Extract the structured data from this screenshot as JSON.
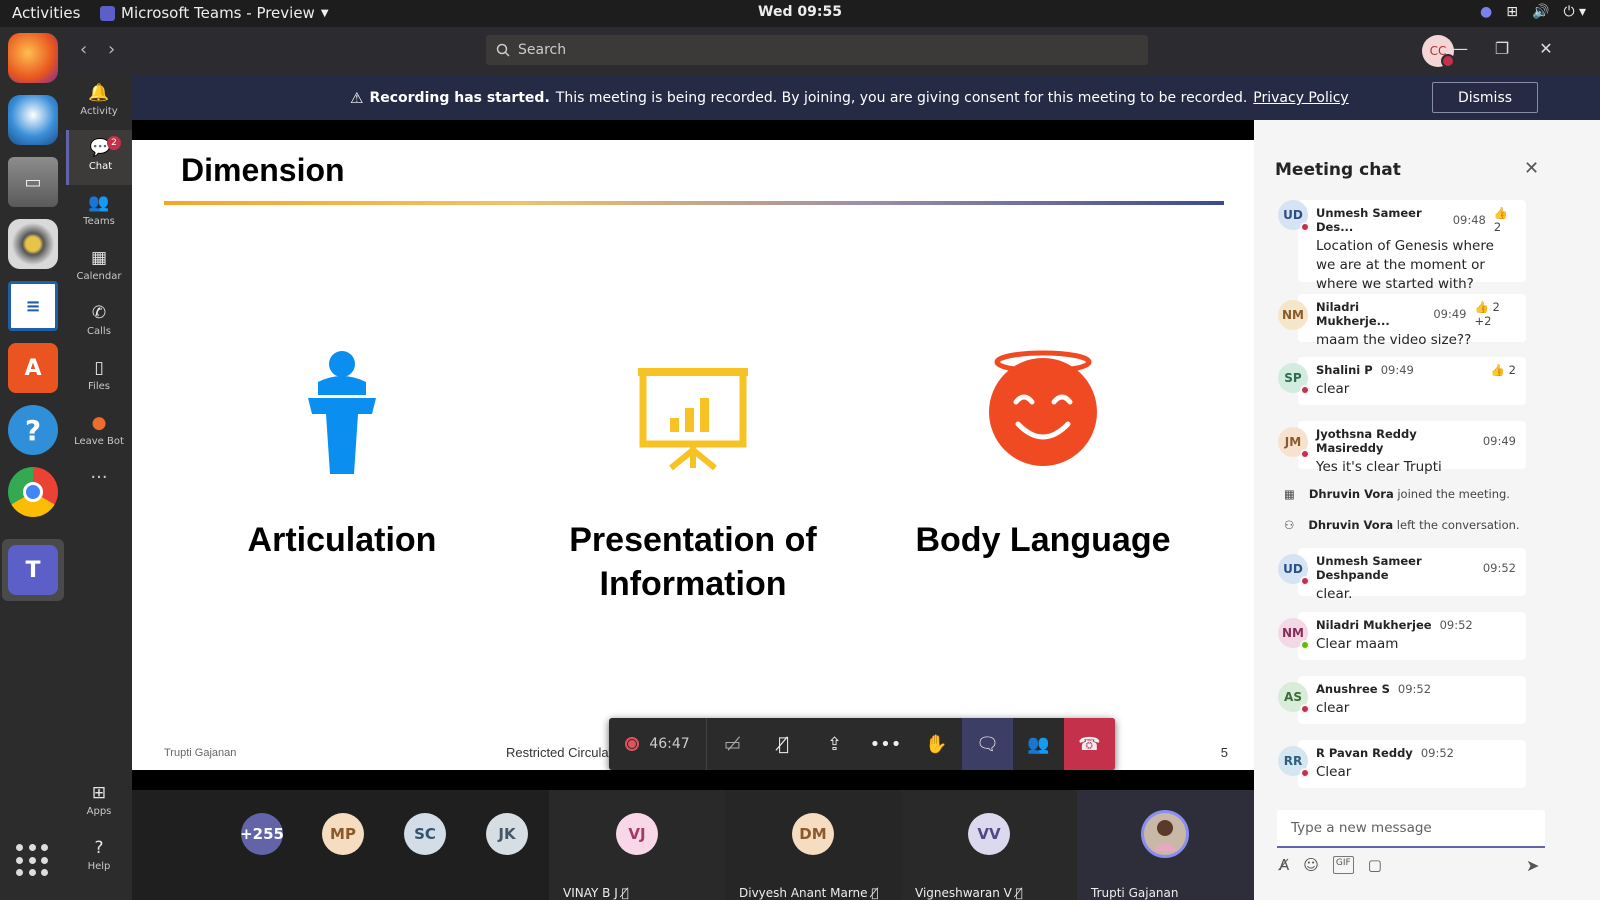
{
  "topbar": {
    "activities": "Activities",
    "app_name": "Microsoft Teams - Preview",
    "clock": "Wed 09:55"
  },
  "dock": {
    "items": [
      "firefox-icon",
      "thunderbird-icon",
      "files-icon",
      "rhythmbox-icon",
      "libreoffice-writer-icon",
      "software-icon",
      "help-icon",
      "chrome-icon",
      "teams-icon"
    ]
  },
  "titlebar": {
    "search_placeholder": "Search",
    "avatar_initials": "CC"
  },
  "appbar": {
    "items": [
      {
        "label": "Activity",
        "icon": "bell-icon"
      },
      {
        "label": "Chat",
        "icon": "chat-icon",
        "badge": "2"
      },
      {
        "label": "Teams",
        "icon": "teams-icon"
      },
      {
        "label": "Calendar",
        "icon": "calendar-icon"
      },
      {
        "label": "Calls",
        "icon": "phone-icon"
      },
      {
        "label": "Files",
        "icon": "file-icon"
      },
      {
        "label": "Leave Bot",
        "icon": "bot-icon"
      }
    ],
    "more": "···",
    "apps": "Apps",
    "help": "Help"
  },
  "banner": {
    "bold": "Recording has started.",
    "text": "This meeting is being recorded. By joining, you are giving consent for this meeting to be recorded.",
    "link": "Privacy Policy",
    "dismiss": "Dismiss"
  },
  "slide": {
    "title": "Dimension",
    "items": [
      {
        "label": "Articulation",
        "icon": "podium-icon"
      },
      {
        "label": "Presentation of Information",
        "icon": "presentation-board-icon"
      },
      {
        "label": "Body Language",
        "icon": "smiley-face-icon"
      }
    ],
    "presenter_mark": "Trupti Gajanan",
    "footer": "Restricted Circulation | L&T Technology Services | www.LTTS.com",
    "page_number": "5"
  },
  "controls": {
    "timer": "46:47"
  },
  "participants": {
    "overflow": "+255",
    "initials": [
      {
        "initials": "MP",
        "bg": "#f6dcc0",
        "fg": "#8a5a2b"
      },
      {
        "initials": "SC",
        "bg": "#d3dde8",
        "fg": "#35536e"
      },
      {
        "initials": "JK",
        "bg": "#d6dde3",
        "fg": "#455766"
      }
    ],
    "tiles": [
      {
        "initials": "VJ",
        "name": "VINAY B J",
        "bg": "#f8d8e6",
        "fg": "#a23a66"
      },
      {
        "initials": "DM",
        "name": "Divyesh Anant Marne",
        "bg": "#f6dcc0",
        "fg": "#8a5a2b"
      },
      {
        "initials": "VV",
        "name": "Vigneshwaran V",
        "bg": "#dcd9ee",
        "fg": "#4e4a85"
      },
      {
        "initials": "",
        "name": "Trupti Gajanan",
        "bg": "#c9b8a6",
        "fg": "#333"
      }
    ]
  },
  "chat": {
    "title": "Meeting chat",
    "messages": [
      {
        "initials": "UD",
        "name": "Unmesh Sameer Des...",
        "time": "09:48",
        "reaction": "👍 2",
        "text": "Location of Genesis where we are at the moment or where we started with?",
        "bg": "#d6e3f4",
        "fg": "#2b4f80",
        "status": "#c4314b"
      },
      {
        "initials": "NM",
        "name": "Niladri Mukherje...",
        "time": "09:49",
        "reaction": "👍 2  +2",
        "text": "maam the video size??",
        "bg": "#f6e6c9",
        "fg": "#8a5a2b",
        "status": ""
      },
      {
        "initials": "SP",
        "name": "Shalini P",
        "time": "09:49",
        "reaction": "👍 2",
        "text": "clear",
        "bg": "#d3ece0",
        "fg": "#2e6b4f",
        "status": "#c4314b"
      },
      {
        "initials": "JM",
        "name": "Jyothsna Reddy Masireddy",
        "time": "09:49",
        "reaction": "",
        "text": "Yes it's clear Trupti",
        "bg": "#f6e2cf",
        "fg": "#8a5a2b",
        "status": "#c4314b"
      },
      {
        "initials": "UD",
        "name": "Unmesh Sameer Deshpande",
        "time": "09:52",
        "reaction": "",
        "text": "clear.",
        "bg": "#d6e3f4",
        "fg": "#2b4f80",
        "status": "#c4314b"
      },
      {
        "initials": "NM",
        "name": "Niladri Mukherjee",
        "time": "09:52",
        "reaction": "",
        "text": "Clear maam",
        "bg": "#f3d9e6",
        "fg": "#8a2d5a",
        "status": "#6bb700"
      },
      {
        "initials": "AS",
        "name": "Anushree S",
        "time": "09:52",
        "reaction": "",
        "text": "clear",
        "bg": "#d9ecd9",
        "fg": "#3a6b3a",
        "status": "#c4314b"
      },
      {
        "initials": "RR",
        "name": "R Pavan Reddy",
        "time": "09:52",
        "reaction": "",
        "text": "Clear",
        "bg": "#d6e6f0",
        "fg": "#2d5f80",
        "status": "#c4314b"
      }
    ],
    "system": [
      {
        "name": "Dhruvin Vora",
        "text": "joined the meeting.",
        "icon": "calendar-join-icon"
      },
      {
        "name": "Dhruvin Vora",
        "text": "left the conversation.",
        "icon": "person-left-icon"
      }
    ],
    "compose_placeholder": "Type a new message"
  },
  "colors": {
    "teams_accent": "#6264a7",
    "banner_bg": "#252a45",
    "hangup": "#c4314b",
    "articulation_blue": "#0a8ef0",
    "presentation_yellow": "#f7c324",
    "body_language_red": "#f04a23"
  }
}
